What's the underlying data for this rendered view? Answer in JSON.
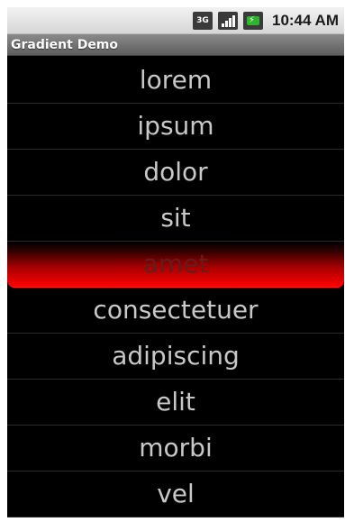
{
  "status_bar": {
    "network_label": "3G",
    "clock": "10:44 AM",
    "icons": [
      "network-3g-icon",
      "signal-strength-icon",
      "battery-charging-icon"
    ]
  },
  "app": {
    "title": "Gradient Demo"
  },
  "list": {
    "selected_index": 4,
    "items": [
      {
        "label": "lorem"
      },
      {
        "label": "ipsum"
      },
      {
        "label": "dolor"
      },
      {
        "label": "sit"
      },
      {
        "label": "amet"
      },
      {
        "label": "consectetuer"
      },
      {
        "label": "adipiscing"
      },
      {
        "label": "elit"
      },
      {
        "label": "morbi"
      },
      {
        "label": "vel"
      }
    ]
  },
  "colors": {
    "selection_gradient_end": "#ff0000",
    "list_background": "#000000",
    "list_text": "#c8c8c8"
  }
}
